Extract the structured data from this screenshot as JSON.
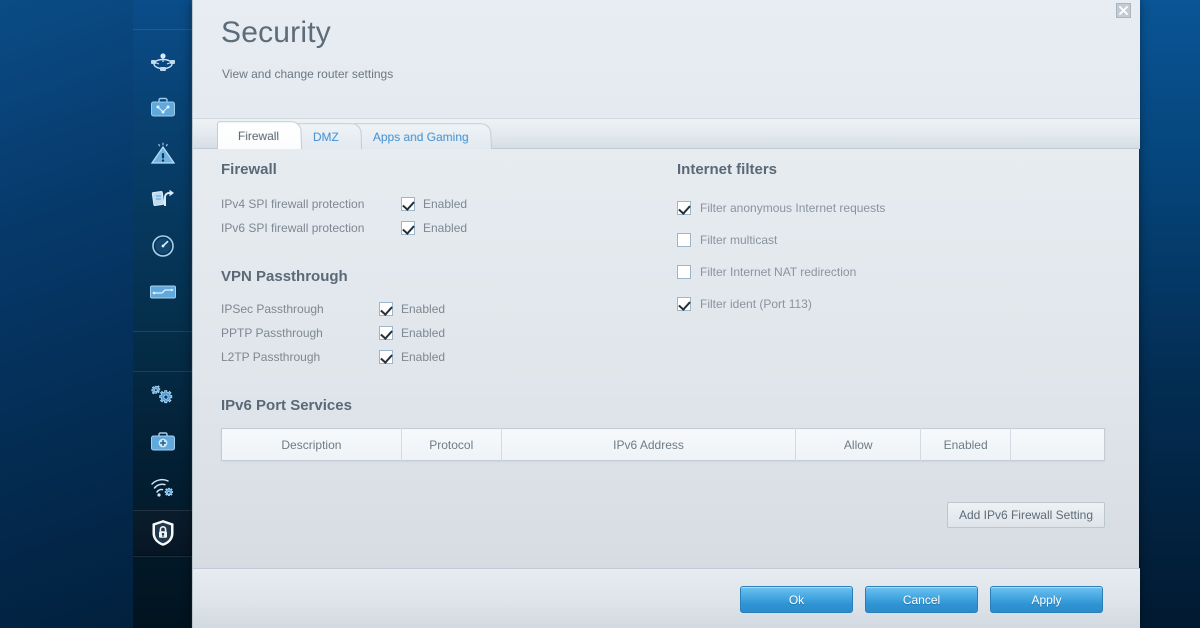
{
  "window": {
    "title": "Security",
    "subtitle": "View and change router settings",
    "close_label": "Close"
  },
  "sidebar": {
    "items": [
      {
        "name": "network-map",
        "icon": "network-map-icon"
      },
      {
        "name": "guest-access",
        "icon": "briefcase-network-icon"
      },
      {
        "name": "parental-controls",
        "icon": "warning-triangle-icon"
      },
      {
        "name": "media-prioritization",
        "icon": "documents-transfer-icon"
      },
      {
        "name": "speed-test",
        "icon": "speed-gauge-icon"
      },
      {
        "name": "usb-storage",
        "icon": "external-storage-icon"
      },
      {
        "name": "connectivity",
        "icon": "gears-icon"
      },
      {
        "name": "troubleshooting",
        "icon": "first-aid-kit-icon"
      },
      {
        "name": "wireless",
        "icon": "wifi-gear-icon"
      },
      {
        "name": "security",
        "icon": "shield-lock-icon",
        "active": true
      }
    ]
  },
  "tabs": [
    {
      "label": "Firewall",
      "active": true
    },
    {
      "label": "DMZ",
      "active": false
    },
    {
      "label": "Apps and Gaming",
      "active": false
    }
  ],
  "firewall": {
    "heading": "Firewall",
    "rows": [
      {
        "label": "IPv4 SPI firewall protection",
        "checked": true,
        "state_label": "Enabled"
      },
      {
        "label": "IPv6 SPI firewall protection",
        "checked": true,
        "state_label": "Enabled"
      }
    ]
  },
  "vpn_passthrough": {
    "heading": "VPN Passthrough",
    "rows": [
      {
        "label": "IPSec Passthrough",
        "checked": true,
        "state_label": "Enabled"
      },
      {
        "label": "PPTP Passthrough",
        "checked": true,
        "state_label": "Enabled"
      },
      {
        "label": "L2TP Passthrough",
        "checked": true,
        "state_label": "Enabled"
      }
    ]
  },
  "internet_filters": {
    "heading": "Internet filters",
    "rows": [
      {
        "label": "Filter anonymous Internet requests",
        "checked": true
      },
      {
        "label": "Filter multicast",
        "checked": false
      },
      {
        "label": "Filter Internet NAT redirection",
        "checked": false
      },
      {
        "label": "Filter ident (Port 113)",
        "checked": true
      }
    ]
  },
  "ipv6_port_services": {
    "heading": "IPv6 Port Services",
    "columns": [
      "Description",
      "Protocol",
      "IPv6 Address",
      "Allow",
      "Enabled",
      ""
    ],
    "rows": [],
    "add_button": "Add IPv6 Firewall Setting"
  },
  "footer": {
    "ok": "Ok",
    "cancel": "Cancel",
    "apply": "Apply"
  },
  "colors": {
    "accent_blue": "#2f93d4",
    "tab_link": "#3f8ed0",
    "panel_bg": "#e6ebf0",
    "heading": "#5b6876",
    "body_text": "#7d8892",
    "desktop_bg": "#04233f"
  }
}
